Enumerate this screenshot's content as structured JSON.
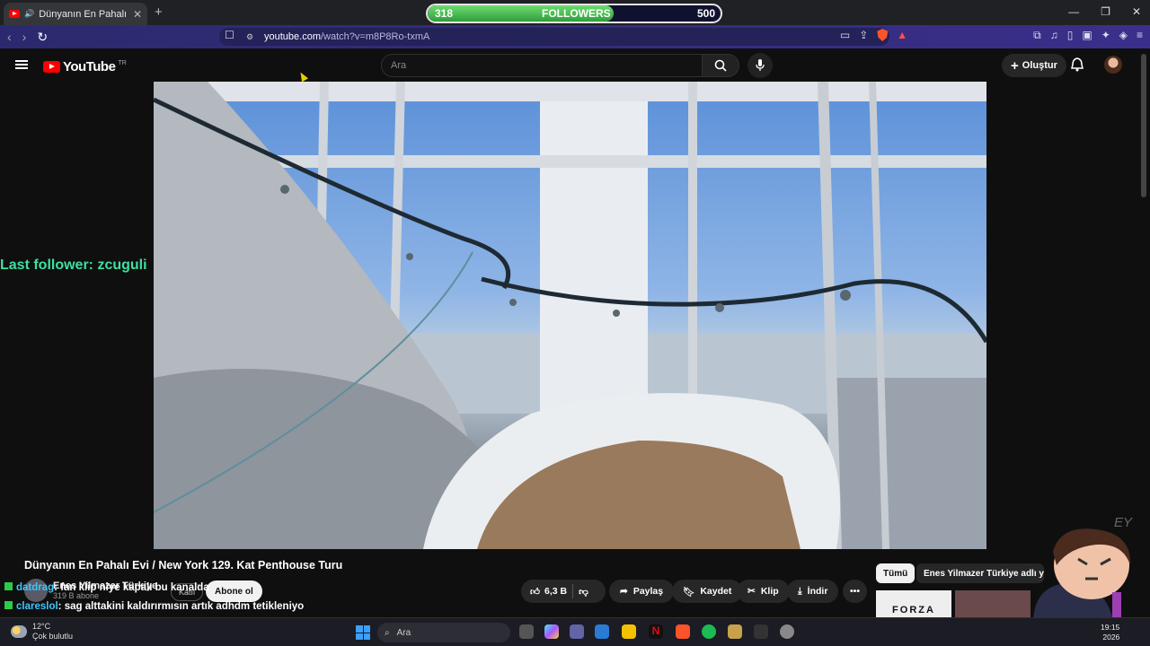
{
  "browser": {
    "tab_title": "Dünyanın En Pahalı Evi / New",
    "new_tab": "+",
    "url_host": "youtube.com",
    "url_path": "/watch?v=m8P8Ro-txmA"
  },
  "overlay": {
    "followers_current": "318",
    "followers_label": "FOLLOWERS",
    "followers_goal": "500",
    "followers_progress": 0.636,
    "last_follower": "Last follower: zcuguli"
  },
  "youtube": {
    "logo": "YouTube",
    "region": "TR",
    "search_placeholder": "Ara",
    "create_label": "Oluştur",
    "video_title": "Dünyanın En Pahalı Evi / New York 129. Kat Penthouse Turu",
    "channel_name": "Enes Yilmazer Türkiye",
    "subscribers": "319 B abone",
    "join_label": "Katıl",
    "subscribe_label": "Abone ol",
    "like_count": "6,3 B",
    "share_label": "Paylaş",
    "save_label": "Kaydet",
    "clip_label": "Klip",
    "download_label": "İndir",
    "chip_all": "Tümü",
    "chip_channel": "Enes Yilmazer Türkiye adlı yükle",
    "thumb_text": "FORZA",
    "watermark": "EY"
  },
  "chat": [
    {
      "user": "datdrag",
      "message": ": fan klip niye kapalı bu kanalda"
    },
    {
      "user": "clareslol",
      "message": ": sag alttakini kaldırırmısın artık adhdm tetikleniyo"
    }
  ],
  "taskbar": {
    "temperature": "12°C",
    "weather": "Çok bulutlu",
    "search": "Ara",
    "time": "19:15",
    "year": "2026"
  }
}
